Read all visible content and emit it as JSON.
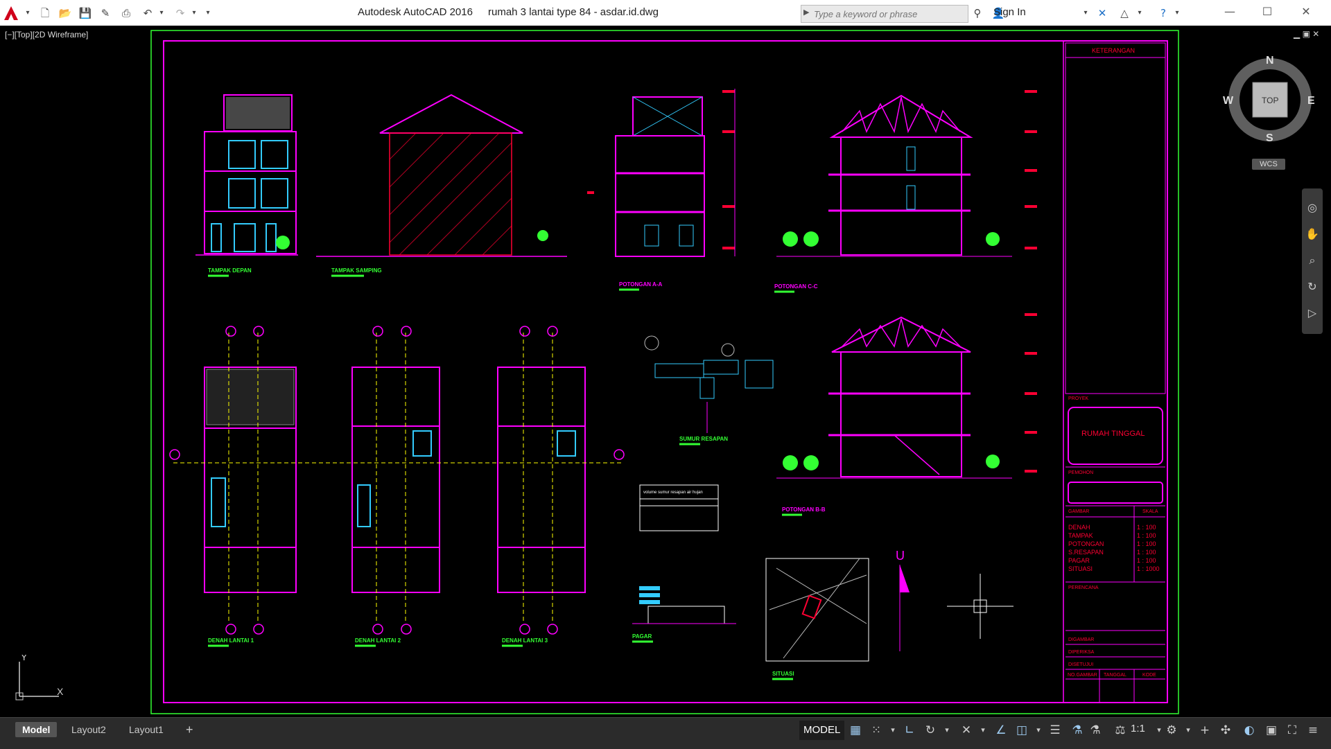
{
  "titlebar": {
    "app_name": "Autodesk AutoCAD 2016",
    "file_name": "rumah 3 lantai type 84 - asdar.id.dwg",
    "search_placeholder": "Type a keyword or phrase",
    "sign_in_label": "Sign In"
  },
  "viewport": {
    "label": "[−][Top][2D Wireframe]"
  },
  "viewcube": {
    "north": "N",
    "south": "S",
    "east": "E",
    "west": "W",
    "face": "TOP",
    "wcs_label": "WCS"
  },
  "drawing": {
    "views": {
      "front_elevation": "TAMPAK DEPAN",
      "side_elevation": "TAMPAK SAMPING",
      "section_aa": "POTONGAN A-A",
      "section_cc": "POTONGAN C-C",
      "section_bb": "POTONGAN B-B",
      "floor1": "DENAH LANTAI 1",
      "floor2": "DENAH LANTAI 2",
      "floor3": "DENAH LANTAI 3",
      "septic": "SUMUR RESAPAN",
      "fence": "PAGAR",
      "site": "SITUASI"
    },
    "north_arrow": "U",
    "title_block": {
      "keterangan": "KETERANGAN",
      "proyek": "PROYEK",
      "project_name": "RUMAH TINGGAL",
      "pemohon": "PEMOHON",
      "gambar_header": "GAMBAR",
      "skala_header": "SKALA",
      "drawings": [
        {
          "name": "DENAH",
          "scale": "1 : 100"
        },
        {
          "name": "TAMPAK",
          "scale": "1 : 100"
        },
        {
          "name": "POTONGAN",
          "scale": "1 : 100"
        },
        {
          "name": "S.RESAPAN",
          "scale": "1 : 100"
        },
        {
          "name": "PAGAR",
          "scale": "1 : 100"
        },
        {
          "name": "SITUASI",
          "scale": "1 : 1000"
        }
      ],
      "perencana": "PERENCANA",
      "digambar": "DIGAMBAR",
      "diperiksa": "DIPERIKSA",
      "disetujui": "DISETUJUI",
      "no_gambar": "NO.GAMBAR",
      "tanggal": "TANGGAL",
      "kode": "KODE"
    },
    "septic_table": {
      "title": "volume sumur resapan air hujan 25 m2 sama dengan 1m3"
    }
  },
  "statusbar": {
    "tabs": [
      "Model",
      "Layout2",
      "Layout1"
    ],
    "add_tab": "+",
    "model_label": "MODEL",
    "scale": "1:1"
  },
  "colors": {
    "frame_green": "#33ff33",
    "magenta": "#ff00ff",
    "red": "#ff0033",
    "cyan": "#33ccff",
    "yellow": "#ffff00",
    "white": "#ffffff"
  }
}
